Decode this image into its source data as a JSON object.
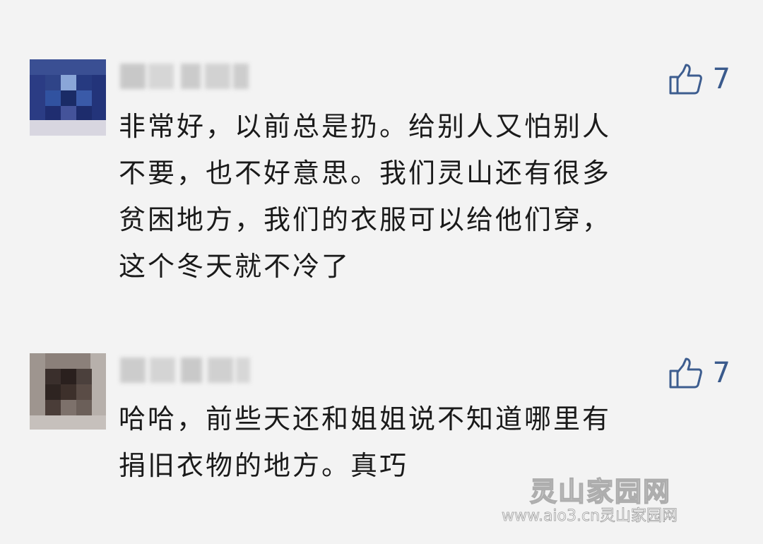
{
  "comments": [
    {
      "like_count": "7",
      "text": "非常好，以前总是扔。给别人又怕别人\n不要，也不好意思。我们灵山还有很多\n贫困地方，我们的衣服可以给他们穿，\n这个冬天就不冷了",
      "icons": {
        "like": "thumbs-up-icon"
      }
    },
    {
      "like_count": "7",
      "text": "哈哈，前些天还和姐姐说不知道哪里有\n捐旧衣物的地方。真巧",
      "icons": {
        "like": "thumbs-up-icon"
      }
    }
  ],
  "watermark": {
    "title": "灵山家园网",
    "subtitle": "www.aio3.cn灵山家园网"
  },
  "colors": {
    "background": "#f3f3f3",
    "text": "#1a1a1a",
    "like_accent": "#3d5d8f"
  }
}
